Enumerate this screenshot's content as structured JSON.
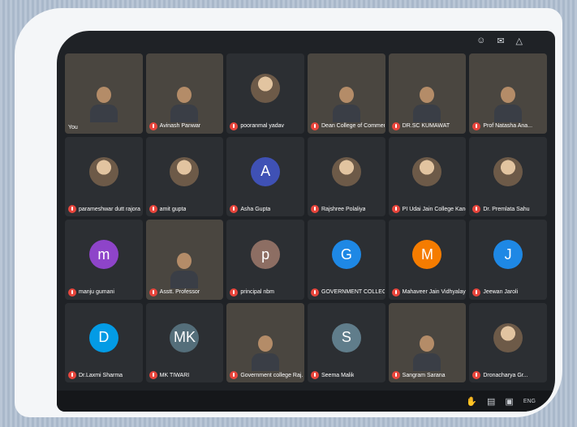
{
  "top_icons": [
    "people-icon",
    "chat-icon",
    "activities-icon"
  ],
  "participants": [
    {
      "name": "You",
      "kind": "self"
    },
    {
      "name": "Avinash Panwar",
      "kind": "video"
    },
    {
      "name": "pooranmal yadav",
      "kind": "photo"
    },
    {
      "name": "Dean College of Commer...",
      "kind": "video"
    },
    {
      "name": "DR.SC KUMAWAT",
      "kind": "video"
    },
    {
      "name": "Prof Natasha Ana...",
      "kind": "video"
    },
    {
      "name": "parameshwar dutt rajora",
      "kind": "photo"
    },
    {
      "name": "amit gupta",
      "kind": "photo"
    },
    {
      "name": "Asha Gupta",
      "kind": "letter",
      "letter": "A",
      "color": "#3f51b5"
    },
    {
      "name": "Rajshree Polaliya",
      "kind": "photo"
    },
    {
      "name": "PI Udai Jain College Kano...",
      "kind": "photo"
    },
    {
      "name": "Dr. Premlata Sahu",
      "kind": "photo"
    },
    {
      "name": "manju gumani",
      "kind": "letter",
      "letter": "m",
      "color": "#8e44c9"
    },
    {
      "name": "Asstt. Professor",
      "kind": "video"
    },
    {
      "name": "principal nbm",
      "kind": "letter",
      "letter": "p",
      "color": "#8d6e63"
    },
    {
      "name": "GOVERNMENT COLLEGE B...",
      "kind": "letter",
      "letter": "G",
      "color": "#1e88e5"
    },
    {
      "name": "Mahaveer Jain Vidhyalaya ...",
      "kind": "letter",
      "letter": "M",
      "color": "#f57c00"
    },
    {
      "name": "Jeewan Jaroli",
      "kind": "letter",
      "letter": "J",
      "color": "#1e88e5"
    },
    {
      "name": "Dr.Laxmi Sharma",
      "kind": "letter",
      "letter": "D",
      "color": "#039be5"
    },
    {
      "name": "MK TIWARI",
      "kind": "letter",
      "letter": "MK",
      "color": "#546e7a"
    },
    {
      "name": "Government college Raj...",
      "kind": "video"
    },
    {
      "name": "Seema Malik",
      "kind": "letter",
      "letter": "S",
      "color": "#607d8b"
    },
    {
      "name": "Sangram Sarana",
      "kind": "video"
    },
    {
      "name": "Dronacharya Gr...",
      "kind": "photo"
    }
  ],
  "bottom_icons": [
    "hand-icon",
    "captions-icon",
    "present-icon"
  ],
  "system_tray": {
    "lang": "ENG"
  }
}
